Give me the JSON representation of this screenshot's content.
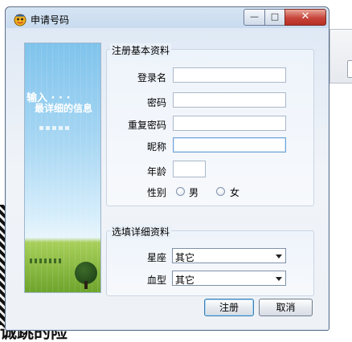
{
  "window": {
    "title": "申请号码",
    "titlebar_buttons": {
      "minimize_glyph": "—",
      "maximize_glyph": "□",
      "close_glyph": "✕"
    }
  },
  "banner": {
    "line1": "输入 · · ·",
    "line2": "最详细的信息"
  },
  "basic_group": {
    "title": "注册基本资料",
    "fields": {
      "login_label": "登录名",
      "login_value": "",
      "password_label": "密码",
      "password_value": "",
      "confirm_password_label": "重复密码",
      "confirm_password_value": "",
      "nickname_label": "昵称",
      "nickname_value": "",
      "age_label": "年龄",
      "age_value": "",
      "gender_label": "性别",
      "gender_male": "男",
      "gender_female": "女"
    }
  },
  "detail_group": {
    "title": "选填详细资料",
    "constellation_label": "星座",
    "constellation_value": "其它",
    "blood_label": "血型",
    "blood_value": "其它"
  },
  "buttons": {
    "register": "注册",
    "cancel": "取消"
  },
  "background": {
    "bottom_text": "诚跳的险"
  },
  "colors": {
    "title_bar": "#c8dbef",
    "close_button": "#c7443a",
    "focus_border": "#6fa3d6"
  }
}
